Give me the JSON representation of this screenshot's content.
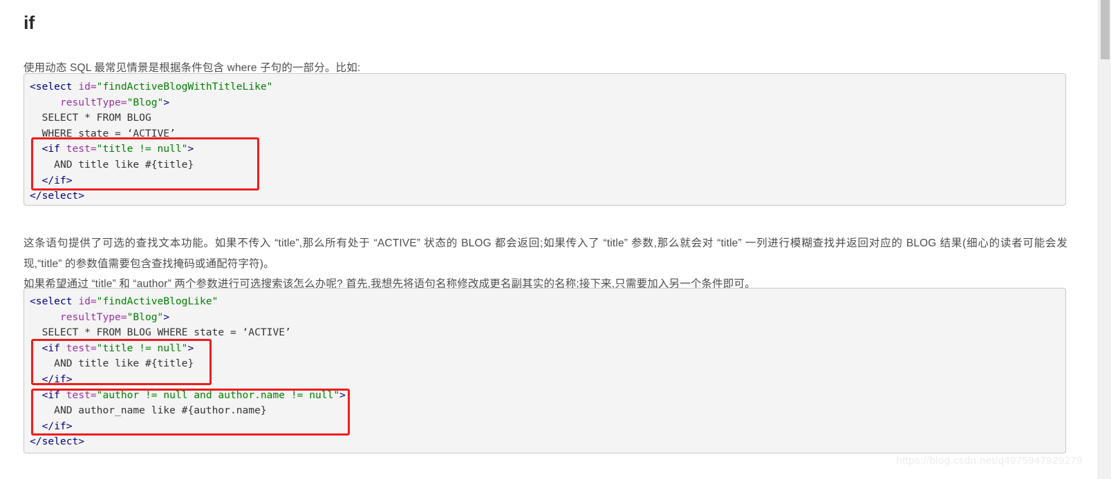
{
  "page": {
    "heading": "if",
    "watermark": "https://blog.csdn.net/q4975947929279"
  },
  "colors": {
    "code_background": "#f4f4f4",
    "code_border": "#c8c8c8",
    "annotation_red": "#ee1c1c",
    "tag_navy": "#000080",
    "attribute_purple": "#9b30a0",
    "string_green": "#008000",
    "text_gray": "#4d4d4d",
    "heading_gray": "#2b2b2b",
    "scrollbar_thumb": "#c1c1c1"
  },
  "paragraphs": {
    "p1": "使用动态 SQL 最常见情景是根据条件包含 where 子句的一部分。比如:",
    "p2": "这条语句提供了可选的查找文本功能。如果不传入 “title”,那么所有处于 “ACTIVE” 状态的 BLOG 都会返回;如果传入了 “title” 参数,那么就会对 “title” 一列进行模糊查找并返回对应的 BLOG 结果(细心的读者可能会发现,“title” 的参数值需要包含查找掩码或通配符字符)。",
    "p3": "如果希望通过 “title” 和 “author” 两个参数进行可选搜索该怎么办呢? 首先,我想先将语句名称修改成更名副其实的名称;接下来,只需要加入另一个条件即可。"
  },
  "code_blocks": [
    {
      "id": "code-block-1",
      "lines": [
        "<select id=\"findActiveBlogWithTitleLike\"",
        "     resultType=\"Blog\">",
        "  SELECT * FROM BLOG",
        "  WHERE state = ‘ACTIVE’",
        "  <if test=\"title != null\">",
        "    AND title like #{title}",
        "  </if>",
        "</select>"
      ],
      "annotations": [
        {
          "name": "if-block-highlight",
          "covers_lines": [
            5,
            6,
            7
          ],
          "color": "#ee1c1c"
        }
      ]
    },
    {
      "id": "code-block-2",
      "lines": [
        "<select id=\"findActiveBlogLike\"",
        "     resultType=\"Blog\">",
        "  SELECT * FROM BLOG WHERE state = ‘ACTIVE’",
        "  <if test=\"title != null\">",
        "    AND title like #{title}",
        "  </if>",
        "  <if test=\"author != null and author.name != null\">",
        "    AND author_name like #{author.name}",
        "  </if>",
        "</select>"
      ],
      "annotations": [
        {
          "name": "if-title-highlight",
          "covers_lines": [
            4,
            5,
            6
          ],
          "color": "#ee1c1c"
        },
        {
          "name": "if-author-highlight",
          "covers_lines": [
            7,
            8,
            9
          ],
          "color": "#ee1c1c"
        }
      ]
    }
  ],
  "scrollbar": {
    "name": "vertical-scrollbar",
    "thumb_position": "top"
  }
}
